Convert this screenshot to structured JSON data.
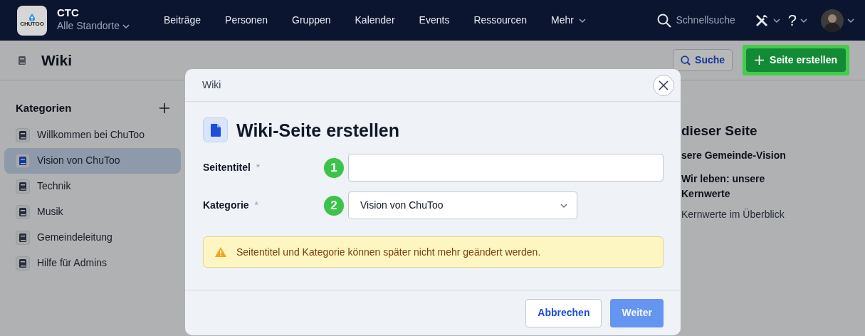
{
  "app": {
    "logo_text": "CHUTOO",
    "org": "CTC",
    "location": "Alle Standorte"
  },
  "nav": [
    {
      "label": "Beiträge",
      "has_menu": false
    },
    {
      "label": "Personen",
      "has_menu": false
    },
    {
      "label": "Gruppen",
      "has_menu": false
    },
    {
      "label": "Kalender",
      "has_menu": false
    },
    {
      "label": "Events",
      "has_menu": false
    },
    {
      "label": "Ressourcen",
      "has_menu": false
    },
    {
      "label": "Mehr",
      "has_menu": true
    }
  ],
  "quick_search": {
    "placeholder": "Schnellsuche"
  },
  "header_menus": [
    {
      "kind": "tools"
    },
    {
      "kind": "help",
      "label": "?"
    },
    {
      "kind": "avatar"
    }
  ],
  "page": {
    "title": "Wiki",
    "search_button": "Suche",
    "create_button": "Seite erstellen",
    "create_highlighted": true
  },
  "sidebar": {
    "title": "Kategorien",
    "items": [
      {
        "label": "Willkommen bei ChuToo",
        "selected": false
      },
      {
        "label": "Vision von ChuToo",
        "selected": true
      },
      {
        "label": "Technik",
        "selected": false
      },
      {
        "label": "Musik",
        "selected": false
      },
      {
        "label": "Gemeindeleitung",
        "selected": false
      },
      {
        "label": "Hilfe für Admins",
        "selected": false
      }
    ]
  },
  "toc": {
    "title": "dieser Seite",
    "items": [
      {
        "label": "sere Gemeinde-Vision"
      },
      {
        "label": "Wir leben: unsere Kernwerte",
        "children": [
          {
            "label": "Kernwerte im Überblick"
          }
        ]
      }
    ]
  },
  "modal": {
    "breadcrumb": "Wiki",
    "title": "Wiki-Seite erstellen",
    "fields": [
      {
        "label": "Seitentitel",
        "required_mark": "*",
        "kind": "text",
        "step": "1"
      },
      {
        "label": "Kategorie",
        "required_mark": "*",
        "kind": "select",
        "step": "2",
        "value": "Vision von ChuToo"
      }
    ],
    "warning": "Seitentitel und Kategorie können später nicht mehr geändert werden.",
    "buttons": [
      {
        "label": "Abbrechen",
        "kind": "secondary",
        "disabled": false
      },
      {
        "label": "Weiter",
        "kind": "primary",
        "disabled": true
      }
    ]
  }
}
